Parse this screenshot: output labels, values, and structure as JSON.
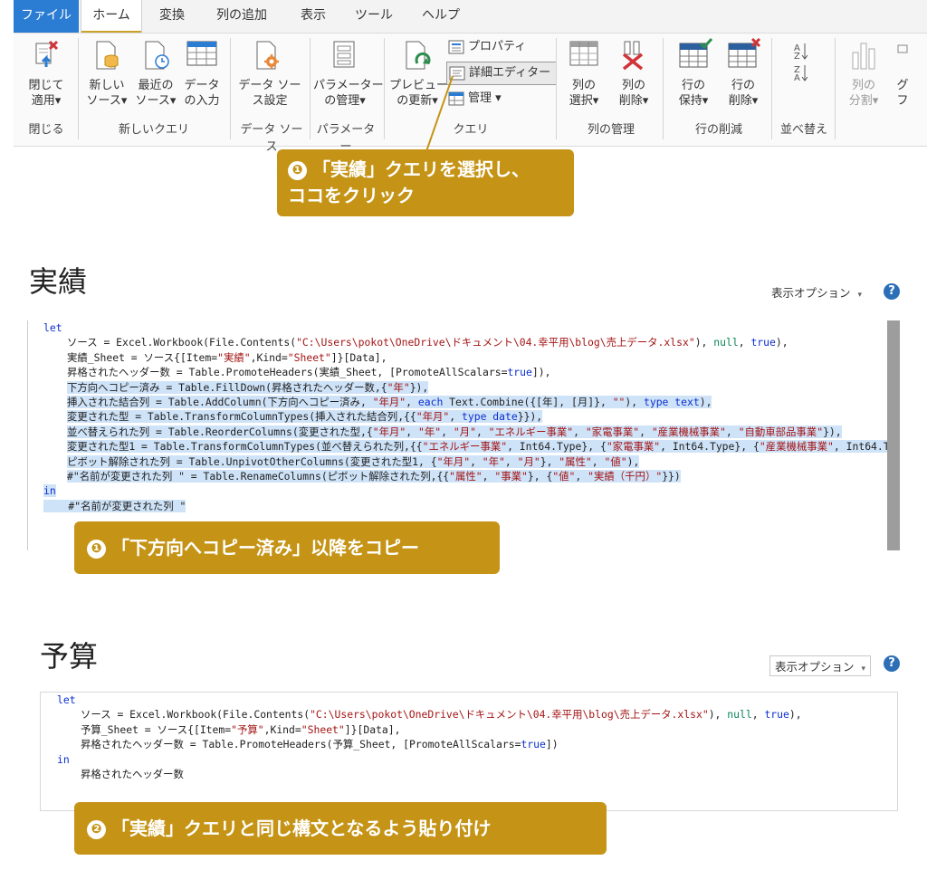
{
  "ribbon": {
    "tabs": [
      "ファイル",
      "ホーム",
      "変換",
      "列の追加",
      "表示",
      "ツール",
      "ヘルプ"
    ],
    "buttons": {
      "close_apply": [
        "閉じて",
        "適用▾"
      ],
      "new_source": [
        "新しい",
        "ソース▾"
      ],
      "recent_sources": [
        "最近の",
        "ソース▾"
      ],
      "enter_data": [
        "データ",
        "の入力"
      ],
      "data_source_settings": [
        "データ ソー",
        "ス設定"
      ],
      "manage_parameters": [
        "パラメーター",
        "の管理▾"
      ],
      "refresh_preview": [
        "プレビュー",
        "の更新▾"
      ],
      "properties": "プロパティ",
      "advanced_editor": "詳細エディター",
      "manage": "管理 ▾",
      "choose_columns": [
        "列の",
        "選択▾"
      ],
      "remove_columns": [
        "列の",
        "削除▾"
      ],
      "keep_rows": [
        "行の",
        "保持▾"
      ],
      "remove_rows": [
        "行の",
        "削除▾"
      ],
      "split_column": [
        "列の",
        "分割▾"
      ],
      "extra": [
        "グ",
        "フ"
      ]
    },
    "groups": [
      "閉じる",
      "新しいクエリ",
      "データ ソース",
      "パラメーター",
      "クエリ",
      "列の管理",
      "行の削減",
      "並べ替え"
    ]
  },
  "callouts": {
    "c1_num": "❶",
    "c1_line1": "「実績」クエリを選択し、",
    "c1_line2": "ココをクリック",
    "c2_num": "❶",
    "c2_text": "「下方向へコピー済み」以降をコピー",
    "c3_num": "❷",
    "c3_text": "「実績」クエリと同じ構文となるよう貼り付け"
  },
  "editor1": {
    "title": "実績",
    "options_label": "表示オプション",
    "help": "?"
  },
  "editor2": {
    "title": "予算",
    "options_label": "表示オプション",
    "help": "?"
  },
  "colors": {
    "accent": "#c59416",
    "file_tab": "#2b7cd3",
    "highlight": "#cfe3f8",
    "keyword": "#0b2fd1",
    "string": "#a31515"
  }
}
